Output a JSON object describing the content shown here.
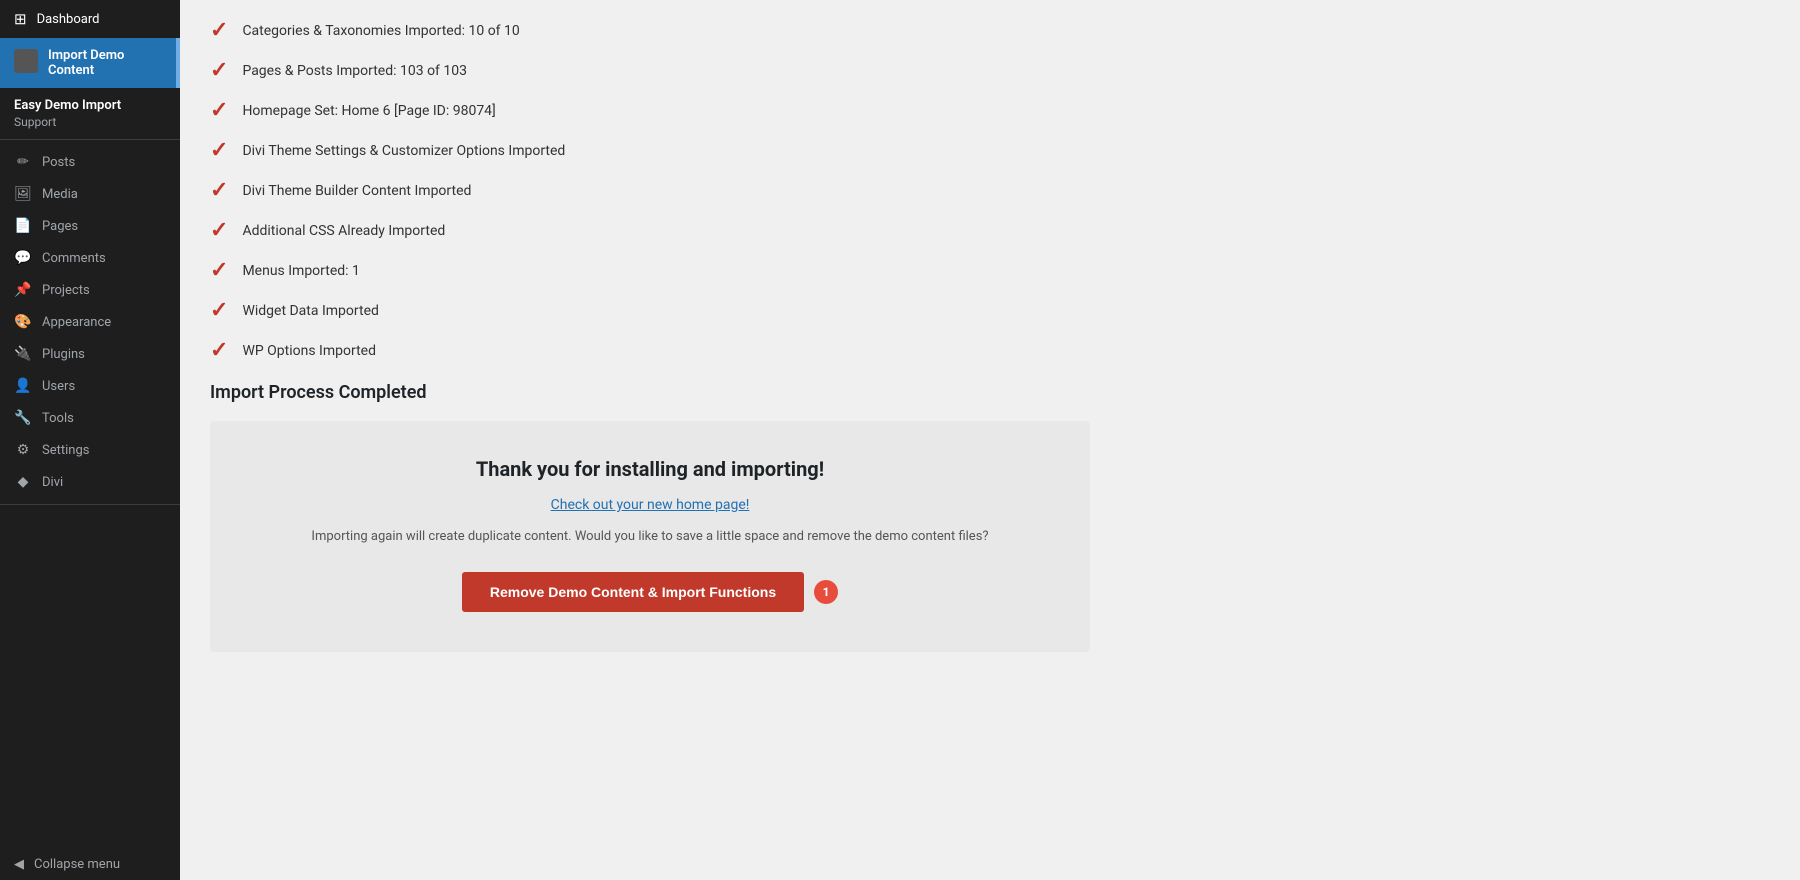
{
  "sidebar": {
    "dashboard_label": "Dashboard",
    "import_demo_label": "Import Demo Content",
    "easy_demo_import_label": "Easy Demo Import",
    "support_label": "Support",
    "items": [
      {
        "id": "posts",
        "label": "Posts",
        "icon": "✏"
      },
      {
        "id": "media",
        "label": "Media",
        "icon": "🖼"
      },
      {
        "id": "pages",
        "label": "Pages",
        "icon": "📄"
      },
      {
        "id": "comments",
        "label": "Comments",
        "icon": "💬"
      },
      {
        "id": "projects",
        "label": "Projects",
        "icon": "📌"
      },
      {
        "id": "appearance",
        "label": "Appearance",
        "icon": "🎨"
      },
      {
        "id": "plugins",
        "label": "Plugins",
        "icon": "🔌"
      },
      {
        "id": "users",
        "label": "Users",
        "icon": "👤"
      },
      {
        "id": "tools",
        "label": "Tools",
        "icon": "🔧"
      },
      {
        "id": "settings",
        "label": "Settings",
        "icon": "⚙"
      },
      {
        "id": "divi",
        "label": "Divi",
        "icon": "◆"
      }
    ],
    "collapse_label": "Collapse menu"
  },
  "main": {
    "check_items": [
      "Categories & Taxonomies Imported: 10 of 10",
      "Pages & Posts Imported: 103 of 103",
      "Homepage Set: Home 6 [Page ID: 98074]",
      "Divi Theme Settings & Customizer Options Imported",
      "Divi Theme Builder Content Imported",
      "Additional CSS Already Imported",
      "Menus Imported: 1",
      "Widget Data Imported",
      "WP Options Imported"
    ],
    "import_complete_heading": "Import Process Completed",
    "completion_box": {
      "title": "Thank you for installing and importing!",
      "link_text": "Check out your new home page!",
      "note": "Importing again will create duplicate content. Would you like to save a little space and remove the demo content files?",
      "button_label": "Remove Demo Content & Import Functions",
      "badge_count": "1"
    }
  }
}
